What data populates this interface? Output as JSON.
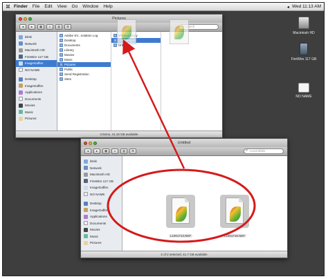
{
  "menubar": {
    "apple": "",
    "items": [
      "Finder",
      "File",
      "Edit",
      "View",
      "Go",
      "Window",
      "Help"
    ],
    "clock": "Wed 11:13 AM"
  },
  "desktop": {
    "icons": [
      {
        "label": "Macintosh HD"
      },
      {
        "label": "FireWire 117 GB"
      },
      {
        "label": "NO NAME"
      }
    ]
  },
  "window_top": {
    "title": "Pictures",
    "search_placeholder": "Search",
    "sidebar": [
      "iDisk",
      "Network",
      "Macintosh HD",
      "FireWire 117 GB",
      "ImageGaffen",
      "NO NAME",
      "Desktop",
      "ImageGaffen",
      "Applications",
      "Documents",
      "Movies",
      "Music",
      "Pictures"
    ],
    "col1": [
      "Adobe SV...notation Log",
      "Desktop",
      "Documents",
      "Library",
      "Movies",
      "Music",
      "Pictures",
      "Public",
      "Send Registration",
      "Sites"
    ],
    "col2": [
      "iPhoto Library",
      "iSort Images",
      "Untitled"
    ],
    "status": "3 items, 41.18 GB available"
  },
  "window_bottom": {
    "title": "Untitled",
    "search_placeholder": "Local disks",
    "sidebar": [
      "iDisk",
      "Network",
      "Macintosh HD",
      "FireWire 117 GB",
      "ImageGaffen",
      "NO NAME",
      "Desktop",
      "ImageGaffen",
      "Applications",
      "Documents",
      "Movies",
      "Music",
      "Pictures"
    ],
    "files": [
      "L1001713.NEF",
      "L1001718.NEF"
    ],
    "status": "2 of 2 selected, 41.7 GB available"
  },
  "colors": {
    "desktop": "#3e3e3e",
    "selection": "#3d7bd1",
    "annotation": "#d41a1a"
  }
}
